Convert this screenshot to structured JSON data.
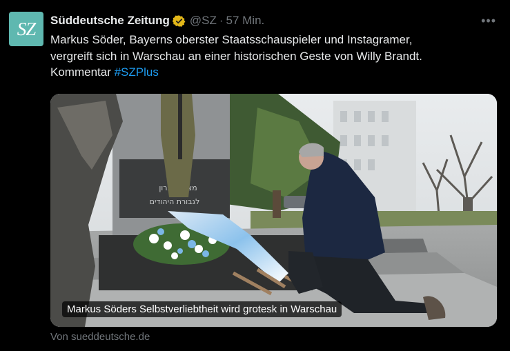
{
  "tweet": {
    "avatar_text": "SZ",
    "account_name": "Süddeutsche Zeitung",
    "handle": "@SZ",
    "separator": "·",
    "time": "57 Min.",
    "more_icon": "ellipsis-icon",
    "verified_icon": "verified-gold-badge-icon",
    "text_line1": "Markus Söder, Bayerns oberster Staatsschauspieler und Instagramer,",
    "text_line2": "vergreift sich in Warschau an einer historischen Geste von Willy Brandt.",
    "text_line3_prefix": "Kommentar ",
    "hashtag": "#SZPlus"
  },
  "media": {
    "caption": "Markus Söders Selbstverliebtheit wird grotesk in Warschau",
    "monument_inscription_line1": "מצבת זיכרון",
    "monument_inscription_line2": "לגבורת היהודים"
  },
  "link_card": {
    "source": "Von sueddeutsche.de"
  },
  "colors": {
    "background": "#000000",
    "text": "#e7e9ea",
    "secondary_text": "#71767b",
    "link": "#1d9bf0",
    "avatar_bg": "#5fb8b0",
    "verified_badge": "#e2b719"
  }
}
